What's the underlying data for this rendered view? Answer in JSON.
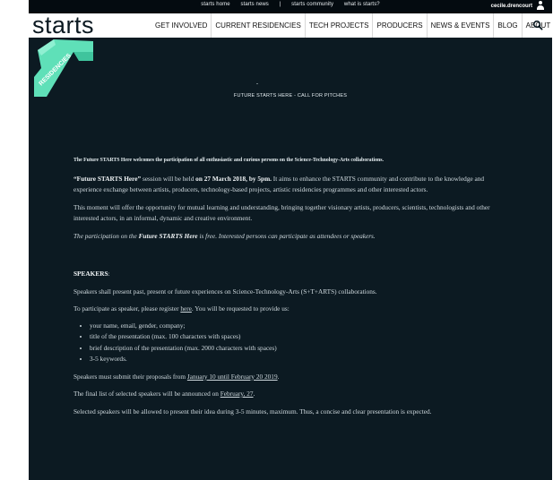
{
  "topbar": {
    "links": [
      "starts home",
      "starts news",
      "|",
      "starts community",
      "what is starts?"
    ],
    "username": "cecile.drencourt"
  },
  "nav": {
    "logo": "starts",
    "items": [
      "GET INVOLVED",
      "CURRENT RESIDENCIES",
      "TECH PROJECTS",
      "PRODUCERS",
      "NEWS & EVENTS",
      "BLOG",
      "ABOUT"
    ]
  },
  "badge": {
    "text": "RESIDENCIES",
    "color": "#5fe0b8"
  },
  "hero": {
    "title": "FUTURE STARTS HERE - CALL FOR PITCHES"
  },
  "body": {
    "intro": "The Future STARTS Here welcomes the participation of all enthusiastic and curious persons on the Science-Technology-Arts collaborations.",
    "p1_a": "“Future STARTS Here”",
    "p1_b": " session will be held ",
    "p1_c": "on 27 March 2018, by 5pm.",
    "p1_d": " It aims to enhance the STARTS community and contribute to the knowledge and experience exchange between artists, producers, technology-based projects, artistic residencies programmes and other interested actors.",
    "p2": "This moment will offer the opportunity for mutual learning and understanding, bringing together visionary artists, producers, scientists, technologists and other interested actors, in an informal, dynamic and creative environment.",
    "p3_a": "The participation on the ",
    "p3_b": "Future STARTS Here",
    "p3_c": " is free. Interested persons can participate as attendees or speakers.",
    "speakers_heading": "SPEAKERS",
    "speakers_colon": ":",
    "s1": "Speakers shall present past, present or future experiences on Science-Technology-Arts (S+T+ARTS) collaborations.",
    "s2_a": "To participate as speaker, please register ",
    "s2_link": "here",
    "s2_c": ". You will be requested to provide us:",
    "list": [
      "your name, email, gender, company;",
      "title of the presentation (max. 100 characters with spaces)",
      "brief description of the presentation (max. 2000 characters with spaces)",
      "3-5 keywords."
    ],
    "s3_a": "Speakers must submit their proposals from ",
    "s3_link": "January 10 until February 20 2019",
    "s3_c": ".",
    "s4_a": "The final list of selected speakers will be announced on ",
    "s4_link": "February, 27",
    "s4_c": ".",
    "s5": "Selected speakers will be allowed to present their idea during 3-5 minutes, maximum. Thus, a concise and clear presentation is expected."
  },
  "colors": {
    "background": "#0c1a22",
    "topbar": "#040b10",
    "accent": "#5fe0b8"
  },
  "icons": {
    "search": "search-icon",
    "user": "user-icon"
  }
}
